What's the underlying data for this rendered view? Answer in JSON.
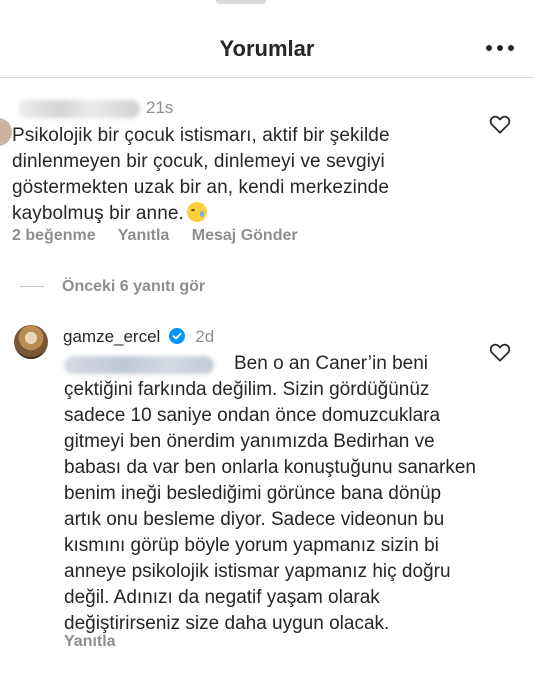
{
  "header": {
    "title": "Yorumlar",
    "more_icon": "more-horizontal-icon"
  },
  "comment": {
    "time": "21s",
    "text": "Psikolojik bir çocuk istismarı, aktif bir şekilde dinlenmeyen bir çocuk, dinlemeyi ve sevgiyi göstermekten uzak bir an, kendi merkezinde kaybolmuş bir anne.",
    "emoji": "crying-face-icon",
    "likes": "2 beğenme",
    "reply_label": "Yanıtla",
    "message_label": "Mesaj Gönder"
  },
  "previous_replies": {
    "label": "Önceki 6 yanıtı gör"
  },
  "reply": {
    "username": "gamze_ercel",
    "time": "2d",
    "text": "Ben o an Caner’in beni çektiğini farkında değilim. Sizin gördüğünüz sadece 10 saniye ondan önce domuzcuklara gitmeyi ben önerdim yanımızda Bedirhan ve babası da var ben onlarla konuştuğunu sanarken benim ineği beslediğimi görünce bana dönüp artık onu besleme diyor. Sadece videonun bu kısmını görüp böyle yorum yapmanız sizin bi anneye psikolojik istismar yapmanız hiç doğru değil. Adınızı da negatif yaşam olarak değiştirirseniz size daha uygun olacak.",
    "reply_label": "Yanıtla"
  },
  "colors": {
    "text": "#262626",
    "secondary": "#8e8e8e",
    "divider": "#dbdbdb",
    "verified": "#0095f6"
  }
}
